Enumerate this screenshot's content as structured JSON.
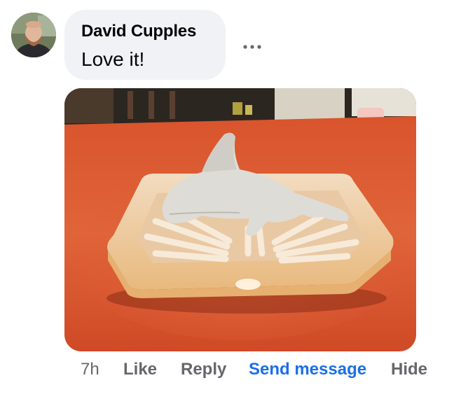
{
  "comment": {
    "author": "David Cupples",
    "text": "Love it!",
    "avatar_icon": "profile-photo",
    "more_icon": "ellipsis-icon",
    "photo_description_icon": "dolphin-soap-dish-photo"
  },
  "actions": {
    "time": "7h",
    "like": "Like",
    "reply": "Reply",
    "send_message": "Send message",
    "hide": "Hide"
  },
  "colors": {
    "bubble": "#f0f2f5",
    "link_blue": "#1b6fe8",
    "muted": "#65676b",
    "text": "#050505"
  }
}
